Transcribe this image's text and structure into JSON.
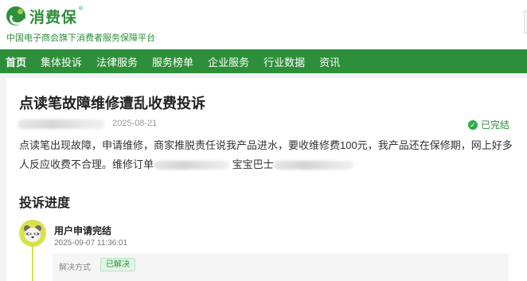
{
  "brand": {
    "name": "消费保",
    "registered_mark": "®",
    "tagline": "中国电子商会旗下消费者服务保障平台"
  },
  "nav": {
    "items": [
      {
        "label": "首页",
        "active": true
      },
      {
        "label": "集体投诉",
        "active": false
      },
      {
        "label": "法律服务",
        "active": false
      },
      {
        "label": "服务榜单",
        "active": false
      },
      {
        "label": "企业服务",
        "active": false
      },
      {
        "label": "行业数据",
        "active": false
      },
      {
        "label": "资讯",
        "active": false
      }
    ]
  },
  "complaint": {
    "title": "点读笔故障维修遭乱收费投诉",
    "date": "2025-08-21",
    "status": "已完结",
    "description_part1": "点读笔出现故障，申请维修，商家推脱责任说我产品进水，要收维修费100元，我产品还在保修期，网上好多人反应收费不合理。维修订单",
    "description_part2": "宝宝巴士"
  },
  "progress": {
    "section_title": "投诉进度",
    "steps": [
      {
        "title": "用户申请完结",
        "time": "2025-09-07 11:36:01",
        "resolution_label": "解决方式",
        "resolution_value": "已解决"
      }
    ]
  },
  "colors": {
    "brand_green": "#2e8f3a",
    "status_green": "#2eaf4a",
    "avatar_yellow": "#d9e14a"
  }
}
